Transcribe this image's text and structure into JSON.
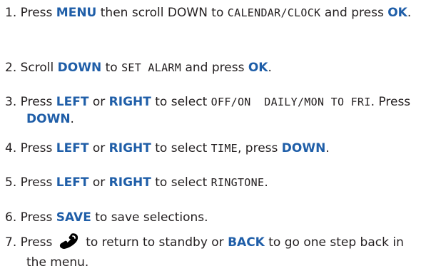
{
  "steps": [
    {
      "num": "1.",
      "parts": [
        "Press ",
        "MENU",
        " then scroll DOWN to ",
        "CALENDAR/CLOCK",
        " and press ",
        "OK",
        "."
      ]
    },
    {
      "num": "2.",
      "parts": [
        "Scroll ",
        "DOWN",
        " to ",
        "SET ALARM",
        " and press ",
        "OK",
        "."
      ]
    },
    {
      "num": "3.",
      "parts": [
        "Press ",
        "LEFT",
        " or ",
        "RIGHT",
        " to select ",
        "OFF/ON  DAILY/MON TO FRI",
        ". Press ",
        "DOWN",
        "."
      ]
    },
    {
      "num": "4.",
      "parts": [
        "Press ",
        "LEFT",
        " or ",
        "RIGHT",
        " to select ",
        "TIME",
        ", press ",
        "DOWN",
        "."
      ]
    },
    {
      "num": "5.",
      "parts": [
        "Press ",
        "LEFT",
        " or ",
        "RIGHT",
        " to select ",
        "RINGTONE",
        "."
      ]
    },
    {
      "num": "6.",
      "parts": [
        " Press ",
        "SAVE",
        " to save selections."
      ]
    },
    {
      "num": "7.",
      "parts": [
        "Press ",
        "handset-end-call-icon",
        " to return to standby or ",
        "BACK",
        " to go one step back in the menu."
      ]
    }
  ],
  "colors": {
    "keyword": "#1f5ea8",
    "text": "#231f20"
  }
}
